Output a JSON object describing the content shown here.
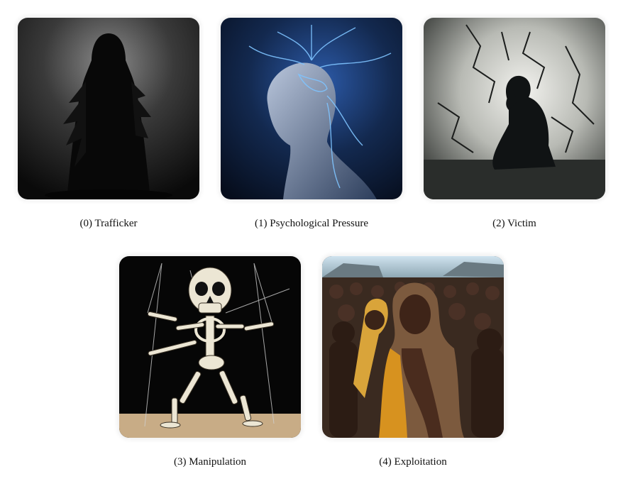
{
  "figures": [
    {
      "label": "(0) Trafficker",
      "image": "hooded-dark-figure"
    },
    {
      "label": "(1) Psychological Pressure",
      "image": "man-with-electric-brain"
    },
    {
      "label": "(2) Victim",
      "image": "person-crouching-against-cracked-wall"
    },
    {
      "label": "(3) Manipulation",
      "image": "skeleton-marionette-on-strings"
    },
    {
      "label": "(4) Exploitation",
      "image": "crowd-of-people-in-village"
    }
  ]
}
